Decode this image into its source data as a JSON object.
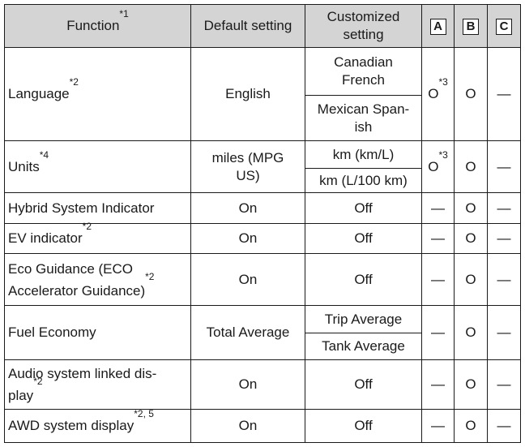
{
  "header": {
    "function": "Function",
    "function_note": "*1",
    "default": "Default setting",
    "customized": "Customized setting",
    "col_a": "A",
    "col_b": "B",
    "col_c": "C"
  },
  "rows": [
    {
      "function": "Language",
      "note": "*2",
      "default": "English",
      "customized": [
        "Canadian French",
        "Mexican Span-ish"
      ],
      "a": "O",
      "a_note": "*3",
      "b": "O",
      "c": "—"
    },
    {
      "function": "Units",
      "note": "*4",
      "default": "miles (MPG US)",
      "customized": [
        "km (km/L)",
        "km (L/100 km)"
      ],
      "a": "O",
      "a_note": "*3",
      "b": "O",
      "c": "—"
    },
    {
      "function": "Hybrid System Indicator",
      "note": "",
      "default": "On",
      "customized": [
        "Off"
      ],
      "a": "—",
      "a_note": "",
      "b": "O",
      "c": "—"
    },
    {
      "function": "EV indicator",
      "note": "*2",
      "default": "On",
      "customized": [
        "Off"
      ],
      "a": "—",
      "a_note": "",
      "b": "O",
      "c": "—"
    },
    {
      "function": "Eco Guidance (ECO Accelerator Guidance)",
      "note": "*2",
      "default": "On",
      "customized": [
        "Off"
      ],
      "a": "—",
      "a_note": "",
      "b": "O",
      "c": "—"
    },
    {
      "function": "Fuel Economy",
      "note": "",
      "default": "Total Average",
      "customized": [
        "Trip Average",
        "Tank Average"
      ],
      "a": "—",
      "a_note": "",
      "b": "O",
      "c": "—"
    },
    {
      "function": "Audio system linked dis-play",
      "note": "*2",
      "default": "On",
      "customized": [
        "Off"
      ],
      "a": "—",
      "a_note": "",
      "b": "O",
      "c": "—"
    },
    {
      "function": "AWD system display",
      "note": "*2, 5",
      "default": "On",
      "customized": [
        "Off"
      ],
      "a": "—",
      "a_note": "",
      "b": "O",
      "c": "—"
    }
  ]
}
